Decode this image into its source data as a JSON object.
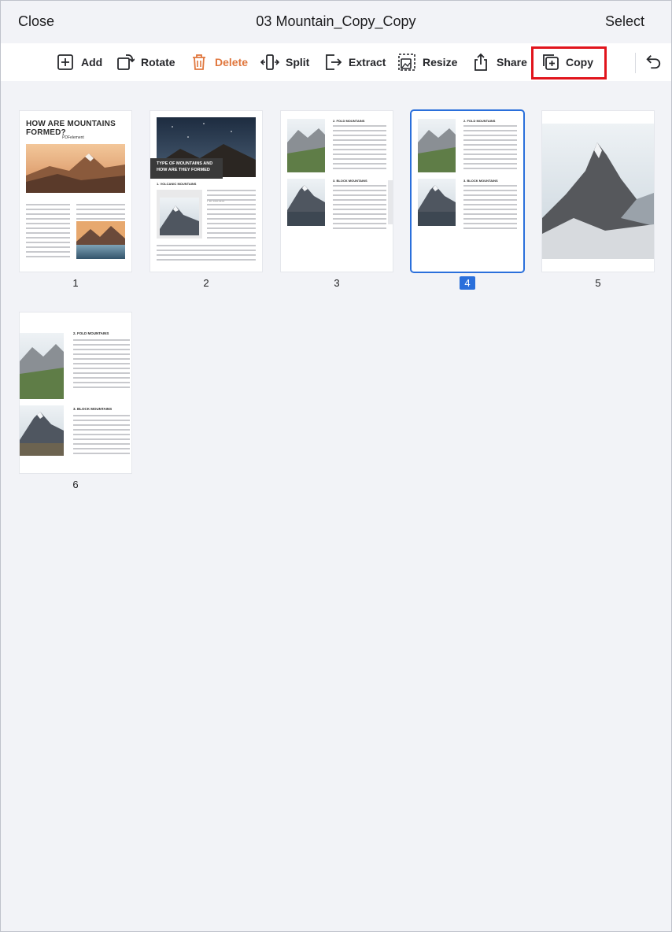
{
  "header": {
    "close_label": "Close",
    "title": "03 Mountain_Copy_Copy",
    "select_label": "Select"
  },
  "toolbar": {
    "items": [
      {
        "label": "Add",
        "icon": "add-page-icon"
      },
      {
        "label": "Rotate",
        "icon": "rotate-icon"
      },
      {
        "label": "Delete",
        "icon": "trash-icon",
        "color": "#e0773e"
      },
      {
        "label": "Split",
        "icon": "split-icon"
      },
      {
        "label": "Extract",
        "icon": "extract-icon"
      },
      {
        "label": "Resize",
        "icon": "resize-icon"
      },
      {
        "label": "Share",
        "icon": "share-icon"
      },
      {
        "label": "Copy",
        "icon": "copy-icon",
        "highlighted": true
      }
    ],
    "undo_icon": "undo-icon",
    "highlight_color": "#e1141c"
  },
  "pages": [
    {
      "number": "1",
      "heading": "HOW ARE MOUNTAINS FORMED?",
      "brand": "PDFelement"
    },
    {
      "number": "2",
      "heading": "TYPE OF MOUNTAINS AND HOW ARE THEY FORMED",
      "subheading": "1. VOLCANIC MOUNTAINS",
      "brand": "PDFelement"
    },
    {
      "number": "3",
      "section1": "2. FOLD MOUNTAINS",
      "section2": "3. BLOCK MOUNTAINS"
    },
    {
      "number": "4",
      "section1": "2. FOLD MOUNTAINS",
      "section2": "3. BLOCK MOUNTAINS",
      "selected": true
    },
    {
      "number": "5"
    },
    {
      "number": "6",
      "section1": "2. FOLD MOUNTAINS",
      "section2": "3. BLOCK MOUNTAINS"
    }
  ],
  "selection_color": "#2a6fdb"
}
